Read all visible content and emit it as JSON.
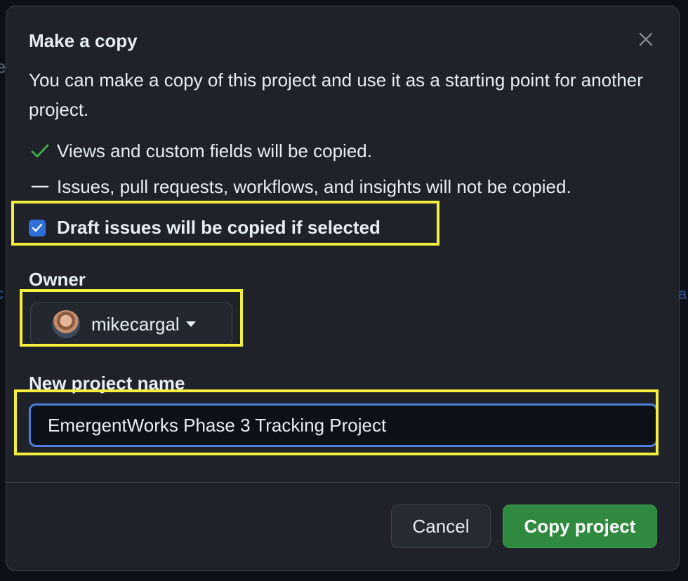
{
  "colors": {
    "accent": "#2f6fd6",
    "primary_button": "#2f8a3f",
    "check": "#3fb950",
    "highlight": "#f5ee3c",
    "dialog_bg": "#1f2329"
  },
  "dialog": {
    "title": "Make a copy",
    "close_icon": "close-icon",
    "description": "You can make a copy of this project and use it as a starting point for another project.",
    "info": [
      {
        "icon": "check-icon",
        "text": "Views and custom fields will be copied."
      },
      {
        "icon": "dash-icon",
        "text": "Issues, pull requests, workflows, and insights will not be copied."
      }
    ],
    "draft_checkbox": {
      "label": "Draft issues will be copied if selected",
      "checked": true
    },
    "owner": {
      "label": "Owner",
      "value": "mikecargal"
    },
    "project_name": {
      "label": "New project name",
      "value": "EmergentWorks Phase 3 Tracking Project"
    },
    "buttons": {
      "cancel": "Cancel",
      "copy": "Copy project"
    }
  }
}
